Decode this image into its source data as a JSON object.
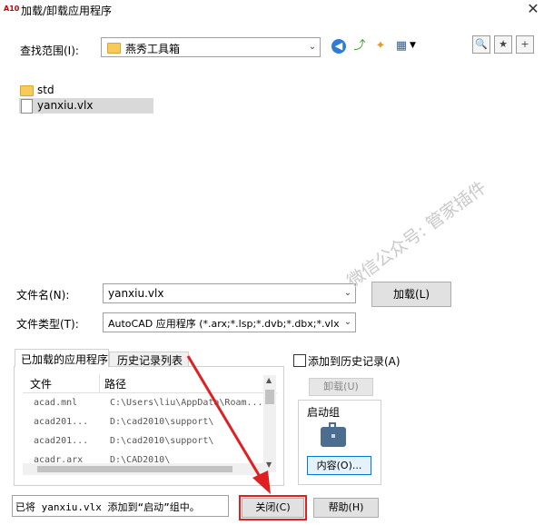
{
  "window": {
    "title": "加载/卸载应用程序",
    "icon_label": "A10"
  },
  "lookin": {
    "label": "查找范围(I):",
    "value": "燕秀工具箱"
  },
  "files": [
    {
      "name": "std",
      "type": "folder"
    },
    {
      "name": "yanxiu.vlx",
      "type": "file"
    }
  ],
  "filename": {
    "label": "文件名(N):",
    "value": "yanxiu.vlx",
    "load_button": "加载(L)"
  },
  "filetype": {
    "label": "文件类型(T):",
    "value": "AutoCAD 应用程序 (*.arx;*.lsp;*.dvb;*.dbx;*.vlx"
  },
  "tabs": [
    "已加载的应用程序",
    "历史记录列表"
  ],
  "loaded_table": {
    "headers": [
      "文件",
      "路径"
    ],
    "rows": [
      {
        "file": "acad.mnl",
        "path": "C:\\Users\\liu\\AppData\\Roam..."
      },
      {
        "file": "acad201...",
        "path": "D:\\cad2010\\support\\"
      },
      {
        "file": "acad201...",
        "path": "D:\\cad2010\\support\\"
      },
      {
        "file": "acadr.arx",
        "path": "D:\\CAD2010\\"
      }
    ]
  },
  "history": {
    "label": "添加到历史记录(A)"
  },
  "unload_button": "卸载(U)",
  "startup": {
    "label": "启动组",
    "contents_button": "内容(O)..."
  },
  "status": {
    "text": "已将 yanxiu.vlx 添加到“启动”组中。"
  },
  "close_button": "关闭(C)",
  "help_button": "帮助(H)",
  "watermark": "微信公众号: 管家插件",
  "colors": {
    "highlight": "#e02020",
    "selected_row": "#d9d9d9"
  }
}
